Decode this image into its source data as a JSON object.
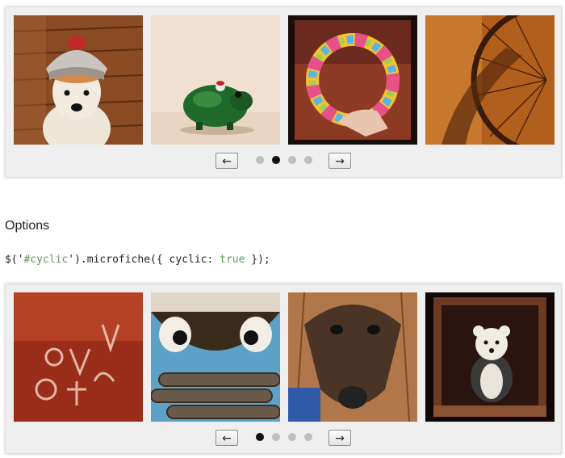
{
  "carousel_1": {
    "prev_label": "←",
    "next_label": "→",
    "pages": 4,
    "active_page": 2
  },
  "options": {
    "heading": "Options",
    "code": {
      "prefix": "$('",
      "selector": "#cyclic",
      "middle": "').microfiche({ cyclic: ",
      "value": "true",
      "suffix": " });"
    }
  },
  "carousel_2": {
    "prev_label": "←",
    "next_label": "→",
    "pages": 4,
    "active_page": 1
  },
  "colors": {
    "dot_active": "#111111",
    "dot_inactive": "#bfbfbf",
    "code_literal": "#5a9a5a",
    "frame_bg": "#efefef"
  }
}
